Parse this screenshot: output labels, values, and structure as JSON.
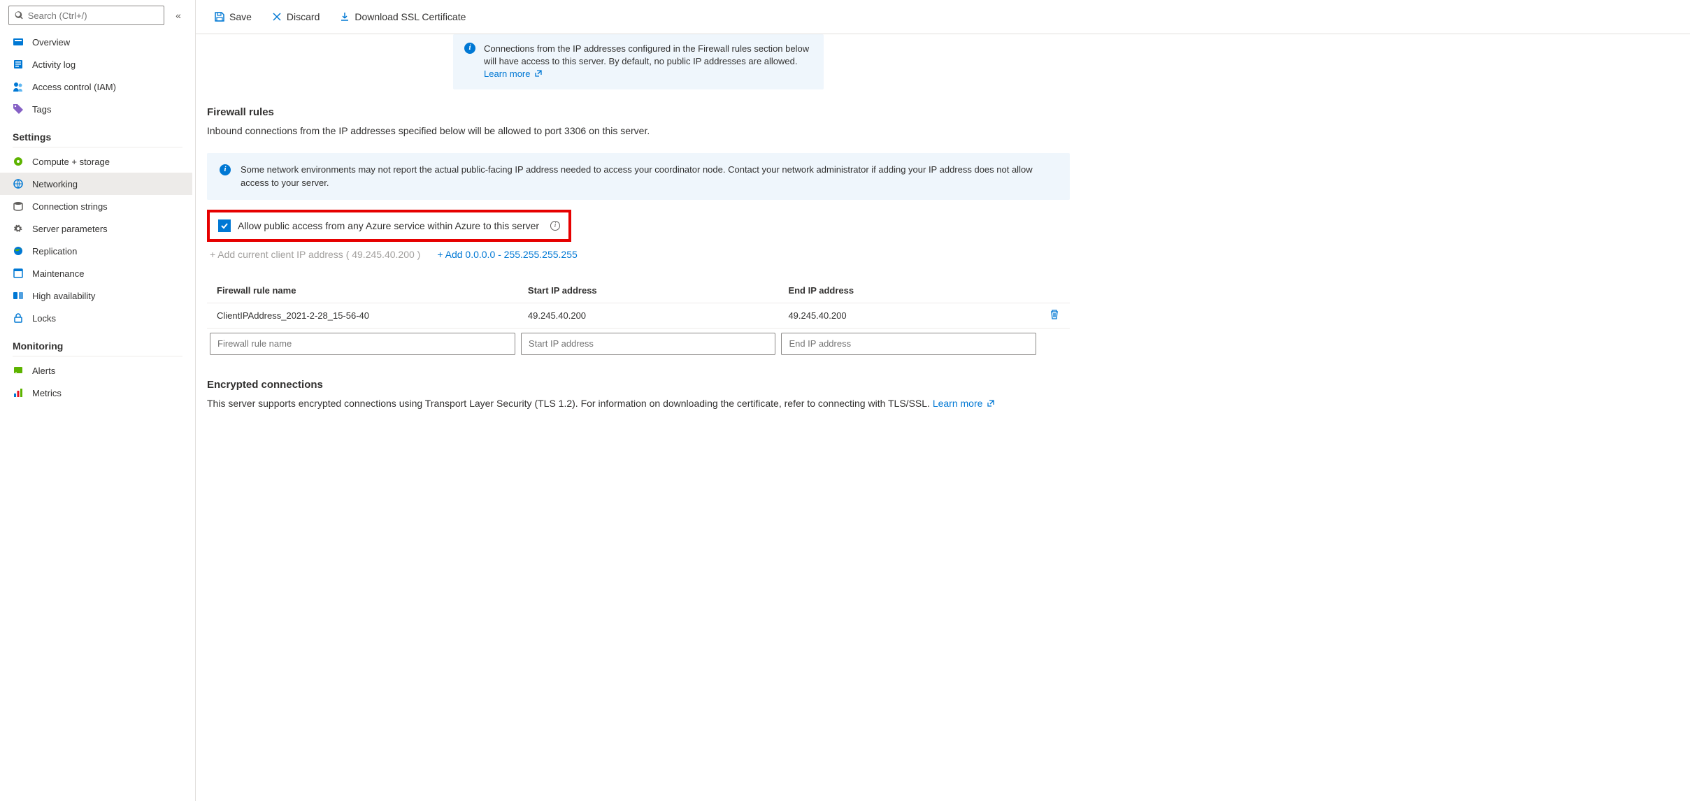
{
  "search": {
    "placeholder": "Search (Ctrl+/)"
  },
  "nav": {
    "top": [
      {
        "label": "Overview"
      },
      {
        "label": "Activity log"
      },
      {
        "label": "Access control (IAM)"
      },
      {
        "label": "Tags"
      }
    ],
    "settings_header": "Settings",
    "settings": [
      {
        "label": "Compute + storage"
      },
      {
        "label": "Networking"
      },
      {
        "label": "Connection strings"
      },
      {
        "label": "Server parameters"
      },
      {
        "label": "Replication"
      },
      {
        "label": "Maintenance"
      },
      {
        "label": "High availability"
      },
      {
        "label": "Locks"
      }
    ],
    "monitoring_header": "Monitoring",
    "monitoring": [
      {
        "label": "Alerts"
      },
      {
        "label": "Metrics"
      }
    ]
  },
  "toolbar": {
    "save": "Save",
    "discard": "Discard",
    "download": "Download SSL Certificate"
  },
  "infobox1": {
    "text": "Connections from the IP addresses configured in the Firewall rules section below will have access to this server. By default, no public IP addresses are allowed. ",
    "learn": "Learn more"
  },
  "firewall": {
    "title": "Firewall rules",
    "desc": "Inbound connections from the IP addresses specified below will be allowed to port 3306 on this server."
  },
  "infobox2": {
    "text": "Some network environments may not report the actual public-facing IP address needed to access your coordinator node. Contact your network administrator if adding your IP address does not allow access to your server."
  },
  "checkbox": {
    "label": "Allow public access from any Azure service within Azure to this server"
  },
  "addlinks": {
    "disabled": "+ Add current client IP address ( 49.245.40.200 )",
    "active": "+ Add 0.0.0.0 - 255.255.255.255"
  },
  "table": {
    "h1": "Firewall rule name",
    "h2": "Start IP address",
    "h3": "End IP address",
    "rows": [
      {
        "name": "ClientIPAddress_2021-2-28_15-56-40",
        "start": "49.245.40.200",
        "end": "49.245.40.200"
      }
    ],
    "ph_name": "Firewall rule name",
    "ph_start": "Start IP address",
    "ph_end": "End IP address"
  },
  "encrypted": {
    "title": "Encrypted connections",
    "desc": "This server supports encrypted connections using Transport Layer Security (TLS 1.2). For information on downloading the certificate, refer to connecting with TLS/SSL. ",
    "learn": "Learn more"
  }
}
